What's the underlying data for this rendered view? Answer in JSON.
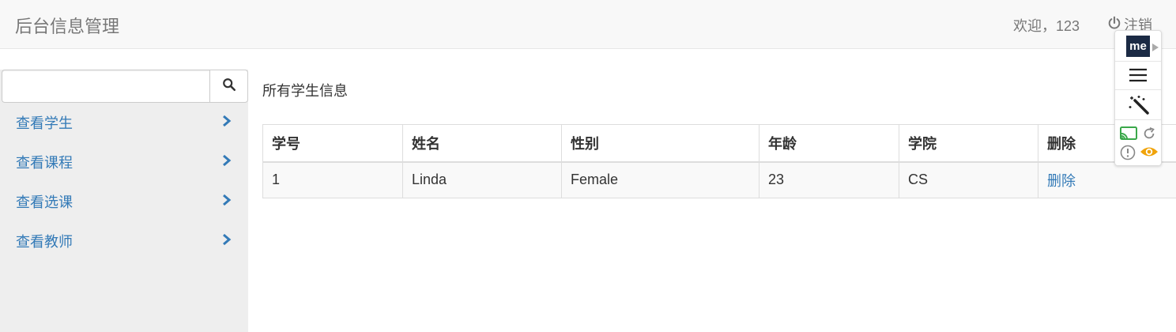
{
  "header": {
    "brand": "后台信息管理",
    "welcome": "欢迎，123",
    "logout_label": "注销"
  },
  "sidebar": {
    "search": {
      "placeholder": "",
      "value": ""
    },
    "items": [
      {
        "label": "查看学生",
        "icon": "chevron-right-icon"
      },
      {
        "label": "查看课程",
        "icon": "chevron-right-icon"
      },
      {
        "label": "查看选课",
        "icon": "chevron-right-icon"
      },
      {
        "label": "查看教师",
        "icon": "chevron-right-icon"
      }
    ]
  },
  "main": {
    "title": "所有学生信息",
    "table": {
      "headers": [
        "学号",
        "姓名",
        "性别",
        "年龄",
        "学院",
        "删除"
      ],
      "rows": [
        [
          "1",
          "Linda",
          "Female",
          "23",
          "CS",
          "删除"
        ]
      ]
    }
  },
  "extension": {
    "logo_text": "me",
    "icons": [
      "menu-icon",
      "magic-wand-icon",
      "cast-icon",
      "refresh-icon",
      "alert-icon",
      "eye-icon"
    ]
  },
  "colors": {
    "link": "#337ab7",
    "navbar_bg": "#f8f8f8",
    "sidebar_bg": "#eeeeee",
    "muted_text": "#777777"
  }
}
